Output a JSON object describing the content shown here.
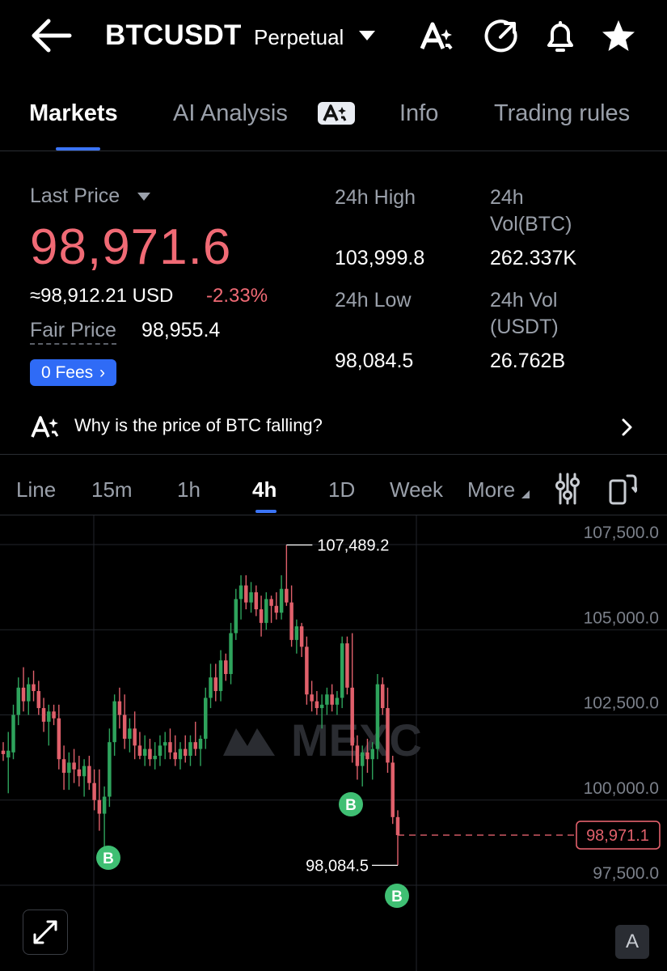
{
  "header": {
    "symbol": "BTCUSDT",
    "contract_type": "Perpetual",
    "icons": [
      "back-arrow-icon",
      "ai-icon",
      "share-icon",
      "bell-icon",
      "star-icon"
    ]
  },
  "tabs": [
    {
      "label": "Markets",
      "active": true
    },
    {
      "label": "AI Analysis",
      "active": false
    },
    {
      "label": "Info",
      "active": false
    },
    {
      "label": "Trading rules",
      "active": false
    }
  ],
  "price": {
    "last_price_label": "Last Price",
    "last_price": "98,971.6",
    "usd_equiv": "≈98,912.21 USD",
    "change_pct": "-2.33%",
    "fair_price_label": "Fair Price",
    "fair_price": "98,955.4",
    "fees_label": "0 Fees"
  },
  "stats": {
    "high_label": "24h High",
    "high_value": "103,999.8",
    "low_label": "24h Low",
    "low_value": "98,084.5",
    "vol_btc_label_1": "24h",
    "vol_btc_label_2": "Vol(BTC)",
    "vol_btc_value": "262.337K",
    "vol_usdt_label_1": "24h Vol",
    "vol_usdt_label_2": "(USDT)",
    "vol_usdt_value": "26.762B"
  },
  "ai_question": "Why is the price of BTC falling?",
  "intervals": [
    {
      "label": "Line",
      "active": false
    },
    {
      "label": "15m",
      "active": false
    },
    {
      "label": "1h",
      "active": false
    },
    {
      "label": "4h",
      "active": true
    },
    {
      "label": "1D",
      "active": false
    },
    {
      "label": "Week",
      "active": false
    },
    {
      "label": "More",
      "active": false
    }
  ],
  "colors": {
    "up": "#2ea35c",
    "down": "#e0606b",
    "accent": "#3b74f6",
    "buy_marker": "#3fbf73"
  },
  "chart_data": {
    "type": "candlestick",
    "y_ticks": [
      "107,500.0",
      "105,000.0",
      "102,500.0",
      "100,000.0",
      "97,500.0"
    ],
    "y_tick_values": [
      107500,
      105000,
      102500,
      100000,
      97500
    ],
    "ylim": [
      97000,
      108000
    ],
    "high_annotation": "107,489.2",
    "low_annotation": "98,084.5",
    "current_price": "98,971.1",
    "current_price_value": 98971.1,
    "watermark": "MEXC",
    "buy_marker_label": "B",
    "candles": [
      {
        "o": 101450,
        "h": 101700,
        "l": 101150,
        "c": 101350
      },
      {
        "o": 101250,
        "h": 102000,
        "l": 100200,
        "c": 101450
      },
      {
        "o": 101400,
        "h": 102800,
        "l": 101200,
        "c": 102500
      },
      {
        "o": 102500,
        "h": 103600,
        "l": 102200,
        "c": 103300
      },
      {
        "o": 103300,
        "h": 103900,
        "l": 102600,
        "c": 102900
      },
      {
        "o": 102900,
        "h": 103600,
        "l": 102500,
        "c": 103400
      },
      {
        "o": 103400,
        "h": 103800,
        "l": 102900,
        "c": 103200
      },
      {
        "o": 103200,
        "h": 103500,
        "l": 102500,
        "c": 102700
      },
      {
        "o": 102700,
        "h": 103000,
        "l": 102000,
        "c": 102300
      },
      {
        "o": 102300,
        "h": 102800,
        "l": 101600,
        "c": 102600
      },
      {
        "o": 102600,
        "h": 102800,
        "l": 102200,
        "c": 102400
      },
      {
        "o": 102400,
        "h": 102800,
        "l": 100900,
        "c": 101200
      },
      {
        "o": 101200,
        "h": 101600,
        "l": 100300,
        "c": 100800
      },
      {
        "o": 100800,
        "h": 101400,
        "l": 100300,
        "c": 101100
      },
      {
        "o": 101100,
        "h": 101500,
        "l": 100500,
        "c": 100900
      },
      {
        "o": 100900,
        "h": 101300,
        "l": 100400,
        "c": 100700
      },
      {
        "o": 100700,
        "h": 101200,
        "l": 100100,
        "c": 101000
      },
      {
        "o": 101000,
        "h": 101300,
        "l": 100300,
        "c": 100500
      },
      {
        "o": 100500,
        "h": 100900,
        "l": 99700,
        "c": 100000
      },
      {
        "o": 100000,
        "h": 100900,
        "l": 99100,
        "c": 99600
      },
      {
        "o": 99600,
        "h": 100400,
        "l": 98600,
        "c": 100100
      },
      {
        "o": 100100,
        "h": 102100,
        "l": 99800,
        "c": 101700
      },
      {
        "o": 101700,
        "h": 103100,
        "l": 101300,
        "c": 102900
      },
      {
        "o": 102900,
        "h": 103300,
        "l": 102100,
        "c": 102500
      },
      {
        "o": 102500,
        "h": 103100,
        "l": 101500,
        "c": 101800
      },
      {
        "o": 101800,
        "h": 102400,
        "l": 101400,
        "c": 102100
      },
      {
        "o": 102100,
        "h": 102600,
        "l": 101200,
        "c": 101600
      },
      {
        "o": 101600,
        "h": 102000,
        "l": 101200,
        "c": 101300
      },
      {
        "o": 101300,
        "h": 101900,
        "l": 101000,
        "c": 101500
      },
      {
        "o": 101500,
        "h": 101800,
        "l": 101000,
        "c": 101200
      },
      {
        "o": 101200,
        "h": 101700,
        "l": 100900,
        "c": 101300
      },
      {
        "o": 101300,
        "h": 101900,
        "l": 101000,
        "c": 101600
      },
      {
        "o": 101600,
        "h": 102000,
        "l": 101200,
        "c": 101700
      },
      {
        "o": 101700,
        "h": 102100,
        "l": 101200,
        "c": 101400
      },
      {
        "o": 101400,
        "h": 101900,
        "l": 101000,
        "c": 101200
      },
      {
        "o": 101200,
        "h": 101700,
        "l": 100900,
        "c": 101500
      },
      {
        "o": 101500,
        "h": 101900,
        "l": 101100,
        "c": 101300
      },
      {
        "o": 101300,
        "h": 101900,
        "l": 101000,
        "c": 101700
      },
      {
        "o": 101700,
        "h": 102300,
        "l": 101300,
        "c": 101500
      },
      {
        "o": 101500,
        "h": 101900,
        "l": 101000,
        "c": 101800
      },
      {
        "o": 101800,
        "h": 103300,
        "l": 101500,
        "c": 103000
      },
      {
        "o": 103000,
        "h": 104000,
        "l": 102700,
        "c": 103600
      },
      {
        "o": 103600,
        "h": 104000,
        "l": 102900,
        "c": 103200
      },
      {
        "o": 103200,
        "h": 104400,
        "l": 102900,
        "c": 104100
      },
      {
        "o": 104100,
        "h": 104300,
        "l": 103500,
        "c": 103700
      },
      {
        "o": 103700,
        "h": 105200,
        "l": 103400,
        "c": 104900
      },
      {
        "o": 104900,
        "h": 106200,
        "l": 104700,
        "c": 105900
      },
      {
        "o": 105900,
        "h": 106600,
        "l": 105300,
        "c": 106300
      },
      {
        "o": 106300,
        "h": 106600,
        "l": 105600,
        "c": 105800
      },
      {
        "o": 105800,
        "h": 106400,
        "l": 105500,
        "c": 106100
      },
      {
        "o": 106100,
        "h": 106300,
        "l": 105400,
        "c": 105600
      },
      {
        "o": 105600,
        "h": 106000,
        "l": 104800,
        "c": 105200
      },
      {
        "o": 105200,
        "h": 106100,
        "l": 105000,
        "c": 105900
      },
      {
        "o": 105900,
        "h": 106000,
        "l": 105200,
        "c": 105700
      },
      {
        "o": 105700,
        "h": 106100,
        "l": 105300,
        "c": 105500
      },
      {
        "o": 105500,
        "h": 106600,
        "l": 105300,
        "c": 106200
      },
      {
        "o": 106200,
        "h": 107489,
        "l": 105700,
        "c": 105800
      },
      {
        "o": 105800,
        "h": 106300,
        "l": 104500,
        "c": 104700
      },
      {
        "o": 104700,
        "h": 105300,
        "l": 104300,
        "c": 105100
      },
      {
        "o": 105100,
        "h": 105200,
        "l": 104200,
        "c": 104500
      },
      {
        "o": 104500,
        "h": 104800,
        "l": 102800,
        "c": 103100
      },
      {
        "o": 103100,
        "h": 103500,
        "l": 102600,
        "c": 102900
      },
      {
        "o": 102900,
        "h": 103200,
        "l": 102500,
        "c": 102700
      },
      {
        "o": 102700,
        "h": 103100,
        "l": 102100,
        "c": 102800
      },
      {
        "o": 102800,
        "h": 103300,
        "l": 102500,
        "c": 103100
      },
      {
        "o": 103100,
        "h": 103400,
        "l": 102600,
        "c": 102800
      },
      {
        "o": 102800,
        "h": 103200,
        "l": 102500,
        "c": 103000
      },
      {
        "o": 103000,
        "h": 104800,
        "l": 102700,
        "c": 104600
      },
      {
        "o": 104600,
        "h": 104800,
        "l": 103100,
        "c": 103300
      },
      {
        "o": 103300,
        "h": 104900,
        "l": 101100,
        "c": 101600
      },
      {
        "o": 101600,
        "h": 101900,
        "l": 100600,
        "c": 101000
      },
      {
        "o": 101000,
        "h": 101600,
        "l": 100400,
        "c": 101400
      },
      {
        "o": 101400,
        "h": 101800,
        "l": 100800,
        "c": 101200
      },
      {
        "o": 101200,
        "h": 101700,
        "l": 100600,
        "c": 101500
      },
      {
        "o": 101500,
        "h": 103700,
        "l": 101200,
        "c": 103400
      },
      {
        "o": 103400,
        "h": 103600,
        "l": 102500,
        "c": 102700
      },
      {
        "o": 102700,
        "h": 103300,
        "l": 100800,
        "c": 101100
      },
      {
        "o": 101100,
        "h": 101300,
        "l": 99300,
        "c": 99500
      },
      {
        "o": 99500,
        "h": 99700,
        "l": 98084.5,
        "c": 98971.1
      }
    ]
  }
}
